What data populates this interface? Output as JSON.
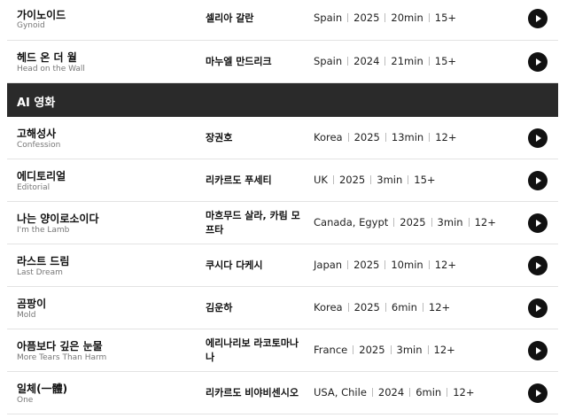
{
  "top_rows": [
    {
      "title_ko": "가이노이드",
      "title_en": "Gynoid",
      "director": "셀리아 갈란",
      "country": "Spain",
      "year": "2025",
      "runtime": "20min",
      "rating": "15+"
    },
    {
      "title_ko": "헤드 온 더 월",
      "title_en": "Head on the Wall",
      "director": "마누엘 만드리크",
      "country": "Spain",
      "year": "2024",
      "runtime": "21min",
      "rating": "15+"
    }
  ],
  "section": {
    "title": "AI 영화"
  },
  "ai_rows": [
    {
      "title_ko": "고해성사",
      "title_en": "Confession",
      "director": "장권호",
      "country": "Korea",
      "year": "2025",
      "runtime": "13min",
      "rating": "12+"
    },
    {
      "title_ko": "에디토리얼",
      "title_en": "Editorial",
      "director": "리카르도 푸세티",
      "country": "UK",
      "year": "2025",
      "runtime": "3min",
      "rating": "15+"
    },
    {
      "title_ko": "나는 양이로소이다",
      "title_en": "I'm the Lamb",
      "director": "마흐무드 살라, 카림 모프타",
      "country": "Canada, Egypt",
      "year": "2025",
      "runtime": "3min",
      "rating": "12+"
    },
    {
      "title_ko": "라스트 드림",
      "title_en": "Last Dream",
      "director": "쿠시다 다케시",
      "country": "Japan",
      "year": "2025",
      "runtime": "10min",
      "rating": "12+"
    },
    {
      "title_ko": "곰팡이",
      "title_en": "Mold",
      "director": "김운하",
      "country": "Korea",
      "year": "2025",
      "runtime": "6min",
      "rating": "12+"
    },
    {
      "title_ko": "아픔보다 깊은 눈물",
      "title_en": "More Tears Than Harm",
      "director": "에리나리보 라코토마나나",
      "country": "France",
      "year": "2025",
      "runtime": "3min",
      "rating": "12+"
    },
    {
      "title_ko": "일체(一體)",
      "title_en": "One",
      "director": "리카르도 비야비센시오",
      "country": "USA, Chile",
      "year": "2024",
      "runtime": "6min",
      "rating": "12+"
    }
  ]
}
